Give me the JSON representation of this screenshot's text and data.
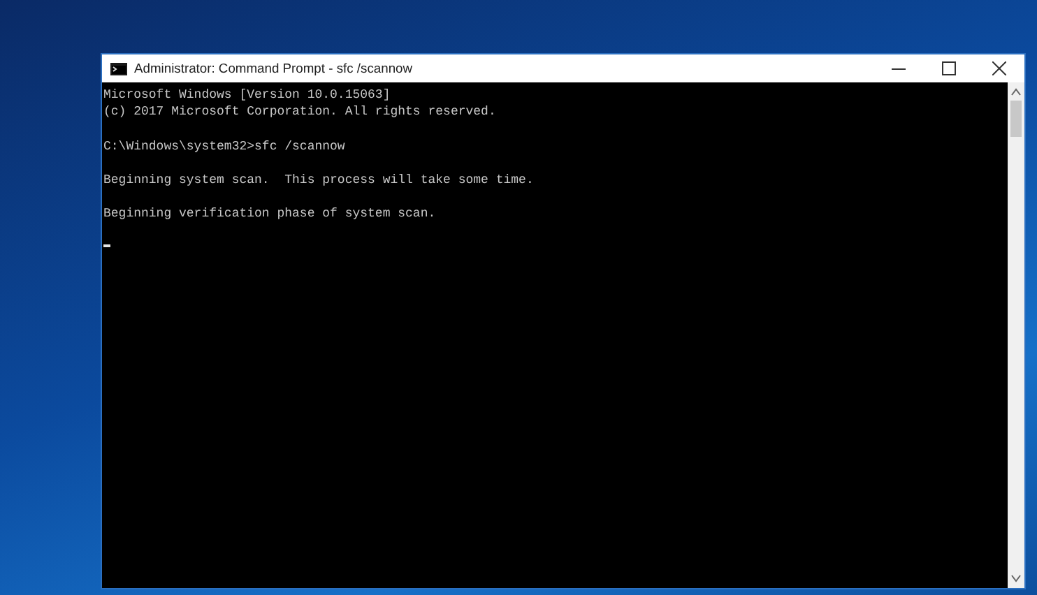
{
  "window": {
    "title": "Administrator: Command Prompt - sfc  /scannow"
  },
  "console": {
    "lines": [
      {
        "text": "Microsoft Windows [Version 10.0.15063]",
        "spaced": false
      },
      {
        "text": "(c) 2017 Microsoft Corporation. All rights reserved.",
        "spaced": false
      },
      {
        "text": "C:\\Windows\\system32>sfc /scannow",
        "spaced": true
      },
      {
        "text": "Beginning system scan.  This process will take some time.",
        "spaced": true
      },
      {
        "text": "Beginning verification phase of system scan.",
        "spaced": true
      }
    ],
    "cursor": true
  }
}
